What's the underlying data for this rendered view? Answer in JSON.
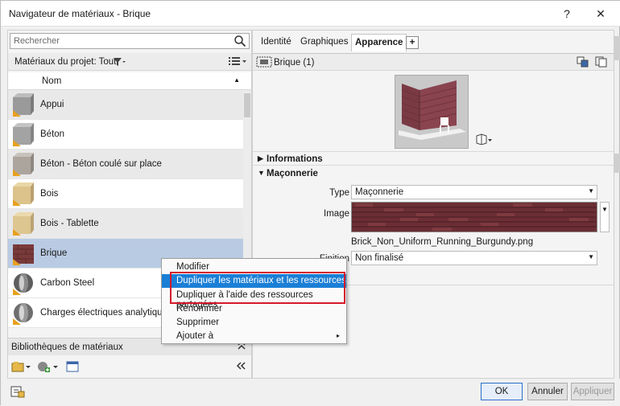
{
  "window": {
    "title": "Navigateur de matériaux - Brique",
    "help": "?",
    "close": "✕"
  },
  "left": {
    "search_placeholder": "Rechercher",
    "project_label": "Matériaux du projet: Tout",
    "column_name": "Nom",
    "materials": [
      {
        "name": "Appui",
        "swatch": "#8f8f8f"
      },
      {
        "name": "Béton",
        "swatch": "#9a9a9a"
      },
      {
        "name": "Béton - Béton coulé sur place",
        "swatch": "#a6a09a"
      },
      {
        "name": "Bois",
        "swatch": "#d8c08a"
      },
      {
        "name": "Bois - Tablette",
        "swatch": "#d9c48e"
      },
      {
        "name": "Brique",
        "swatch": "#7a3a3a"
      },
      {
        "name": "Carbon Steel",
        "swatch": "#6a6a6a"
      },
      {
        "name": "Charges électriques analytiques",
        "swatch": "#7a7a7a"
      }
    ],
    "library_label": "Bibliothèques de matériaux"
  },
  "right": {
    "tabs": [
      "Identité",
      "Graphiques",
      "Apparence"
    ],
    "active_tab": "Apparence",
    "add_tab": "+",
    "asset_name": "Brique (1)",
    "section_info": "Informations",
    "section_masonry": "Maçonnerie",
    "type_label": "Type",
    "type_value": "Maçonnerie",
    "image_label": "Image",
    "image_filename": "Brick_Non_Uniform_Running_Burgundy.png",
    "finish_label": "Finition",
    "finish_value": "Non finalisé"
  },
  "context_menu": {
    "items": [
      {
        "label": "Modifier"
      },
      {
        "label": "Dupliquer les matériaux et les ressources"
      },
      {
        "label": "Dupliquer à l'aide des ressources partagées"
      },
      {
        "label": "Renommer"
      },
      {
        "label": "Supprimer"
      },
      {
        "label": "Ajouter à",
        "submenu": "▸"
      }
    ],
    "highlighted_index": 1
  },
  "buttons": {
    "ok": "OK",
    "cancel": "Annuler",
    "apply": "Appliquer"
  },
  "colors": {
    "highlight": "#1a7fd6",
    "red_outline": "#d4192a",
    "selected_row": "#b9cbe3"
  }
}
